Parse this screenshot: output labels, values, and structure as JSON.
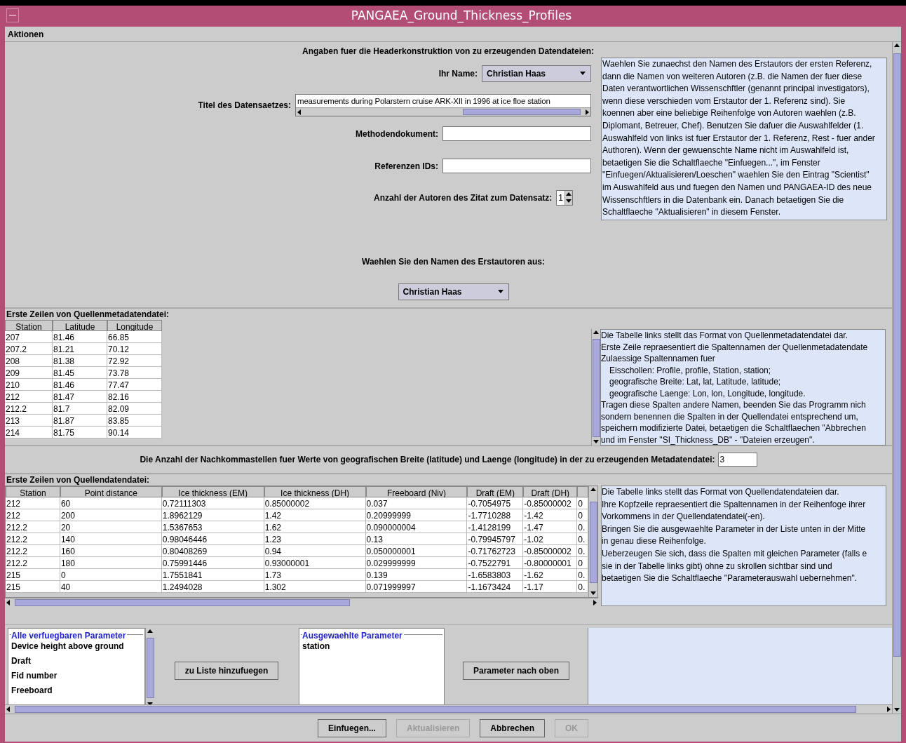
{
  "window": {
    "title": "PANGAEA_Ground_Thickness_Profiles"
  },
  "menu": [
    "Aktionen"
  ],
  "header_section": {
    "heading": "Angaben fuer die Headerkonstruktion von zu erzeugenden Datendateien:",
    "name_label": "Ihr Name:",
    "name_value": "Christian Haas",
    "title_label": "Titel des Datensaetzes:",
    "title_value": "measurements during Polarstern cruise ARK-XII in 1996 at ice floe station",
    "method_label": "Methodendokument:",
    "references_label": "Referenzen IDs:",
    "authors_label": "Anzahl der Autoren des Zitat zum Datensatz:",
    "authors_value": "1",
    "help_lines": [
      "Waehlen Sie zunaechst den Namen des Erstautors der ersten Referenz,",
      "dann die Namen von weiteren Autoren (z.B. die Namen der fuer diese",
      "Daten verantwortlichen Wissenschftler (genannt principal investigators),",
      "wenn diese verschieden vom Erstautor der 1. Referenz sind). Sie",
      "koennen aber eine beliebige Reihenfolge von Autoren waehlen (z.B.",
      "Diplomant, Betreuer, Chef). Benutzen Sie dafuer die Auswahlfelder (1.",
      "Auswahlfeld von links ist fuer Erstautor der 1. Referenz, Rest - fuer ander",
      "Authoren). Wenn der gewuenschte Name nicht im Auswahlfeld ist,",
      "betaetigen Sie die Schaltflaeche \"Einfuegen...\", im Fenster",
      "\"Einfuegen/Aktualisieren/Loeschen\" waehlen Sie den Eintrag \"Scientist\"",
      "im Auswahlfeld aus und fuegen den Namen und PANGAEA-ID des neue",
      "Wissenschftlers in die Datenbank ein. Danach betaetigen Sie die",
      "Schaltflaeche \"Aktualisieren\" in diesem Fenster."
    ],
    "first_author_label": "Waehlen Sie den Namen des Erstautoren aus:",
    "first_author_value": "Christian Haas"
  },
  "metadata_section": {
    "label": "Erste Zeilen von Quellenmetadatendatei:",
    "table": {
      "columns": [
        "Station",
        "Latitude",
        "Longitude"
      ],
      "rows": [
        [
          "207",
          "81.46",
          "66.85"
        ],
        [
          "207.2",
          "81.21",
          "70.12"
        ],
        [
          "208",
          "81.38",
          "72.92"
        ],
        [
          "209",
          "81.45",
          "73.78"
        ],
        [
          "210",
          "81.46",
          "77.47"
        ],
        [
          "212",
          "81.47",
          "82.16"
        ],
        [
          "212.2",
          "81.7",
          "82.09"
        ],
        [
          "213",
          "81.87",
          "83.85"
        ],
        [
          "214",
          "81.75",
          "90.14"
        ]
      ]
    },
    "help_lines": [
      {
        "kind": "plain",
        "text": "Die Tabelle links stellt das Format von Quellenmetadatendatei dar."
      },
      {
        "kind": "plain",
        "text": "Erste Zeile repraesentiert die Spaltennamen der Quellenmetadatendate"
      },
      {
        "kind": "plain",
        "text": "Zulaessige Spaltennamen fuer"
      },
      {
        "kind": "indented",
        "text": "Eisschollen: Profile, profile, Station, station;"
      },
      {
        "kind": "indented",
        "text": "geografische Breite: Lat, lat, Latitude, latitude;"
      },
      {
        "kind": "indented",
        "text": "geografische Laenge: Lon, lon, Longitude, longitude."
      },
      {
        "kind": "plain",
        "text": "Tragen diese Spalten andere Namen, beenden Sie das Programm nich"
      },
      {
        "kind": "plain",
        "text": "sondern benennen die Spalten in der Quellendatei entsprechend um,"
      },
      {
        "kind": "plain",
        "text": "speichern modifizierte Datei, betaetigen die Schaltflaechen \"Abbrechen"
      },
      {
        "kind": "plain",
        "text": "und im Fenster \"SI_Thickness_DB\" - \"Dateien erzeugen\"."
      }
    ]
  },
  "decimals": {
    "label": "Die Anzahl der Nachkommastellen fuer Werte von geografischen Breite (latitude) und Laenge (longitude) in der zu erzeugenden Metadatendatei:",
    "value": "3"
  },
  "data_section": {
    "label": "Erste Zeilen von Quellendatendatei:",
    "table": {
      "columns": [
        "Station",
        "Point distance",
        "Ice thickness (EM)",
        "Ice thickness (DH)",
        "Freeboard (Niv)",
        "Draft (EM)",
        "Draft (DH)"
      ],
      "rows": [
        [
          "212",
          "60",
          "0.72111303",
          "0.85000002",
          "0.037",
          "-0.7054975",
          "-0.85000002",
          "0"
        ],
        [
          "212",
          "200",
          "1.8962129",
          "1.42",
          "0.20999999",
          "-1.7710288",
          "-1.42",
          "0"
        ],
        [
          "212.2",
          "20",
          "1.5367653",
          "1.62",
          "0.090000004",
          "-1.4128199",
          "-1.47",
          "0."
        ],
        [
          "212.2",
          "140",
          "0.98046446",
          "1.23",
          "0.13",
          "-0.79945797",
          "-1.02",
          "0."
        ],
        [
          "212.2",
          "160",
          "0.80408269",
          "0.94",
          "0.050000001",
          "-0.71762723",
          "-0.85000002",
          "0."
        ],
        [
          "212.2",
          "180",
          "0.75991446",
          "0.93000001",
          "0.029999999",
          "-0.7522791",
          "-0.80000001",
          "0"
        ],
        [
          "215",
          "0",
          "1.7551841",
          "1.73",
          "0.139",
          "-1.6583803",
          "-1.62",
          "0."
        ],
        [
          "215",
          "40",
          "1.2494028",
          "1.302",
          "0.071999997",
          "-1.1673424",
          "-1.17",
          "0."
        ]
      ]
    },
    "help_lines": [
      "Die Tabelle links stellt das Format von Quellendatendateien dar.",
      "Ihre Kopfzeile repraesentiert die Spaltennamen in der Reihenfoge ihrer",
      "Vorkommens in der Quellendatendatei(-en).",
      "Bringen Sie die ausgewaehlte Parameter in der Liste unten in der Mitte",
      "in genau diese Reihenfolge.",
      "Ueberzeugen Sie sich, dass die Spalten mit gleichen Parameter (falls e",
      "sie in der Tabelle links gibt) ohne zu skrollen sichtbar sind und",
      "betaetigen Sie die Schaltflaeche \"Parameterauswahl uebernehmen\"."
    ]
  },
  "parameters": {
    "available_title": "Alle verfuegbaren Parameter",
    "available": [
      "Device height above ground",
      "Draft",
      "Fid number",
      "Freeboard"
    ],
    "add_button": "zu Liste hinzufuegen",
    "selected_title": "Ausgewaehlte Parameter",
    "selected": [
      "station"
    ],
    "up_button": "Parameter nach oben"
  },
  "buttons": [
    {
      "label": "Einfuegen...",
      "disabled": false
    },
    {
      "label": "Aktualisieren",
      "disabled": true
    },
    {
      "label": "Abbrechen",
      "disabled": false
    },
    {
      "label": "OK",
      "disabled": true
    }
  ]
}
